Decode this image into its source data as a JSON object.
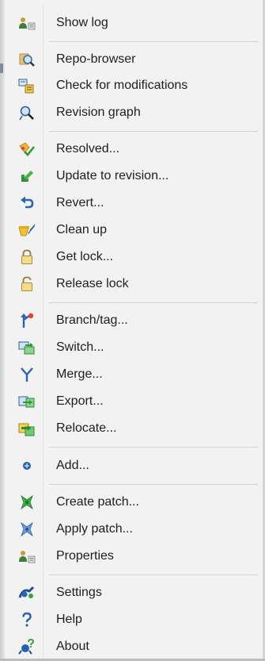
{
  "menu": {
    "items": [
      {
        "label": "Show log",
        "icon": "show-log-icon",
        "name": "menu-item-show-log"
      },
      {
        "label": "Repo-browser",
        "icon": "repo-browser-icon",
        "name": "menu-item-repo-browser"
      },
      {
        "label": "Check for modifications",
        "icon": "check-modifications-icon",
        "name": "menu-item-check-for-modifications"
      },
      {
        "label": "Revision graph",
        "icon": "revision-graph-icon",
        "name": "menu-item-revision-graph"
      },
      {
        "label": "Resolved...",
        "icon": "resolved-icon",
        "name": "menu-item-resolved"
      },
      {
        "label": "Update to revision...",
        "icon": "update-to-revision-icon",
        "name": "menu-item-update-to-revision"
      },
      {
        "label": "Revert...",
        "icon": "revert-icon",
        "name": "menu-item-revert"
      },
      {
        "label": "Clean up",
        "icon": "clean-up-icon",
        "name": "menu-item-clean-up"
      },
      {
        "label": "Get lock...",
        "icon": "lock-icon",
        "name": "menu-item-get-lock"
      },
      {
        "label": "Release lock",
        "icon": "unlock-icon",
        "name": "menu-item-release-lock"
      },
      {
        "label": "Branch/tag...",
        "icon": "branch-tag-icon",
        "name": "menu-item-branch-tag"
      },
      {
        "label": "Switch...",
        "icon": "switch-icon",
        "name": "menu-item-switch"
      },
      {
        "label": "Merge...",
        "icon": "merge-icon",
        "name": "menu-item-merge"
      },
      {
        "label": "Export...",
        "icon": "export-icon",
        "name": "menu-item-export"
      },
      {
        "label": "Relocate...",
        "icon": "relocate-icon",
        "name": "menu-item-relocate"
      },
      {
        "label": "Add...",
        "icon": "add-icon",
        "name": "menu-item-add"
      },
      {
        "label": "Create patch...",
        "icon": "create-patch-icon",
        "name": "menu-item-create-patch"
      },
      {
        "label": "Apply patch...",
        "icon": "apply-patch-icon",
        "name": "menu-item-apply-patch"
      },
      {
        "label": "Properties",
        "icon": "properties-icon",
        "name": "menu-item-properties"
      },
      {
        "label": "Settings",
        "icon": "settings-icon",
        "name": "menu-item-settings"
      },
      {
        "label": "Help",
        "icon": "help-icon",
        "name": "menu-item-help"
      },
      {
        "label": "About",
        "icon": "about-icon",
        "name": "menu-item-about"
      }
    ]
  }
}
